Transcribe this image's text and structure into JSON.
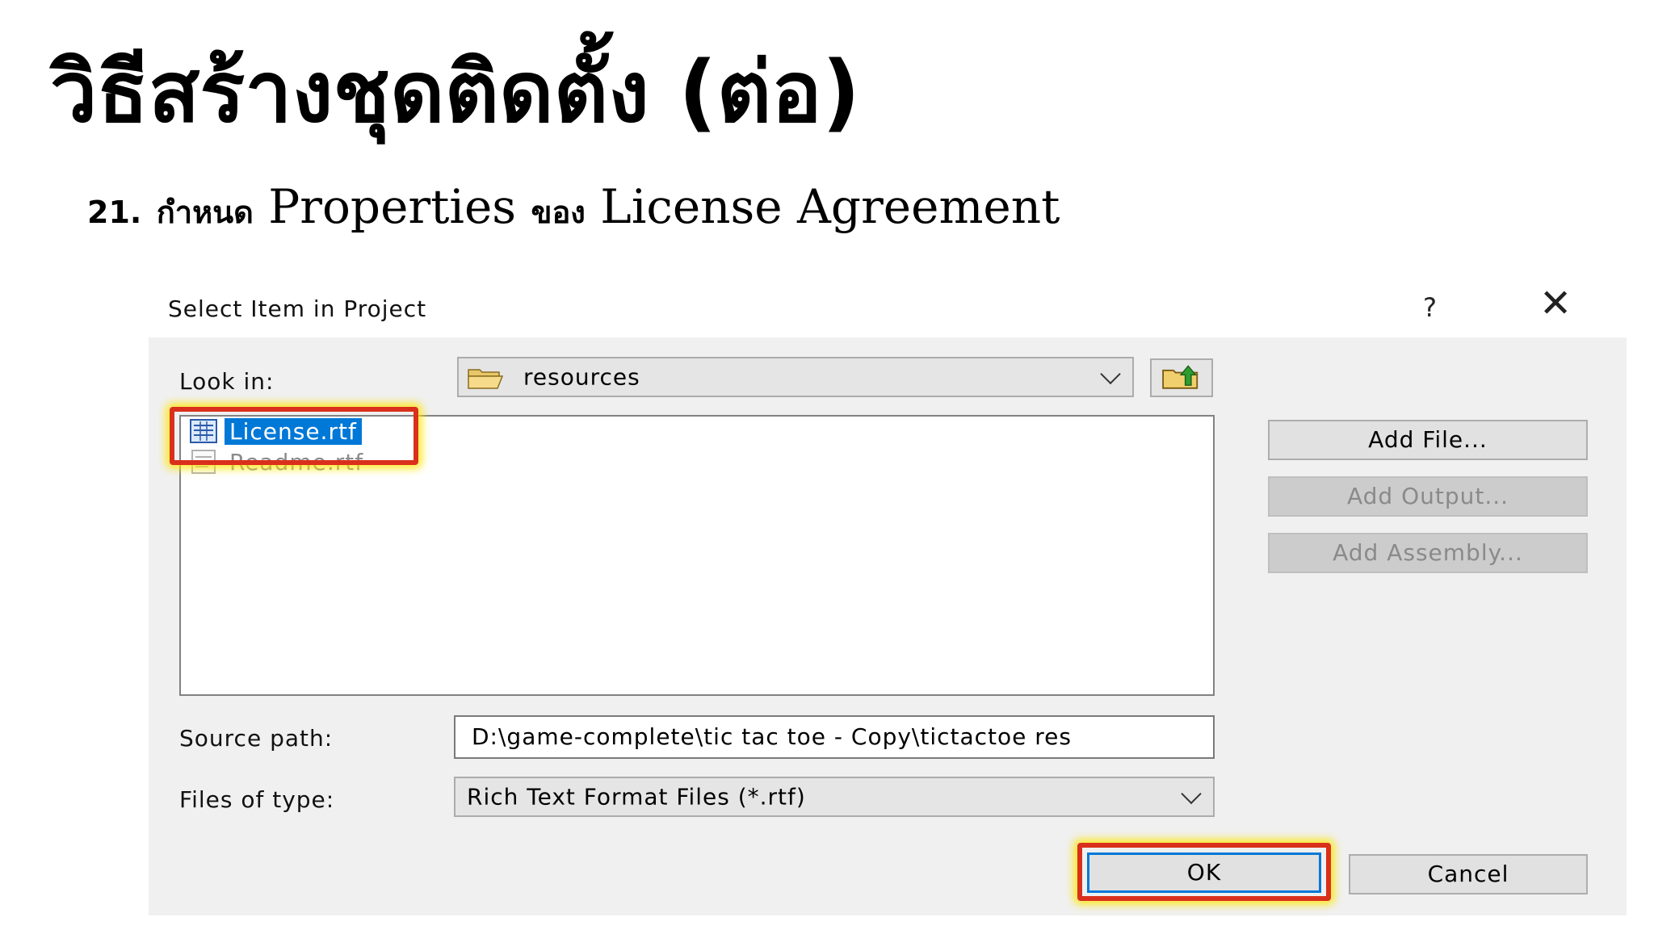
{
  "slide": {
    "title": "วิธีสร้างชุดติดตั้ง (ต่อ)",
    "step_number": "21.",
    "step_prefix": "กำหนด",
    "step_properties": "Properties",
    "step_of": "ของ",
    "step_target": "License Agreement"
  },
  "dialog": {
    "title": "Select Item in Project",
    "help_label": "?",
    "close_label": "✕",
    "look_in_label": "Look in:",
    "look_in_value": "resources",
    "files": [
      {
        "name": "License.rtf",
        "selected": true
      },
      {
        "name": "Readme.rtf",
        "selected": false
      }
    ],
    "buttons": {
      "add_file": "Add File...",
      "add_output": "Add Output...",
      "add_assembly": "Add Assembly...",
      "ok": "OK",
      "cancel": "Cancel"
    },
    "source_path_label": "Source path:",
    "source_path_value": "D:\\game-complete\\tic tac toe - Copy\\tictactoe res",
    "files_of_type_label": "Files of type:",
    "files_of_type_value": "Rich Text Format Files (*.rtf)"
  },
  "colors": {
    "highlight_border": "#d9301b",
    "highlight_glow": "#ffe600",
    "selection": "#0078d7"
  }
}
